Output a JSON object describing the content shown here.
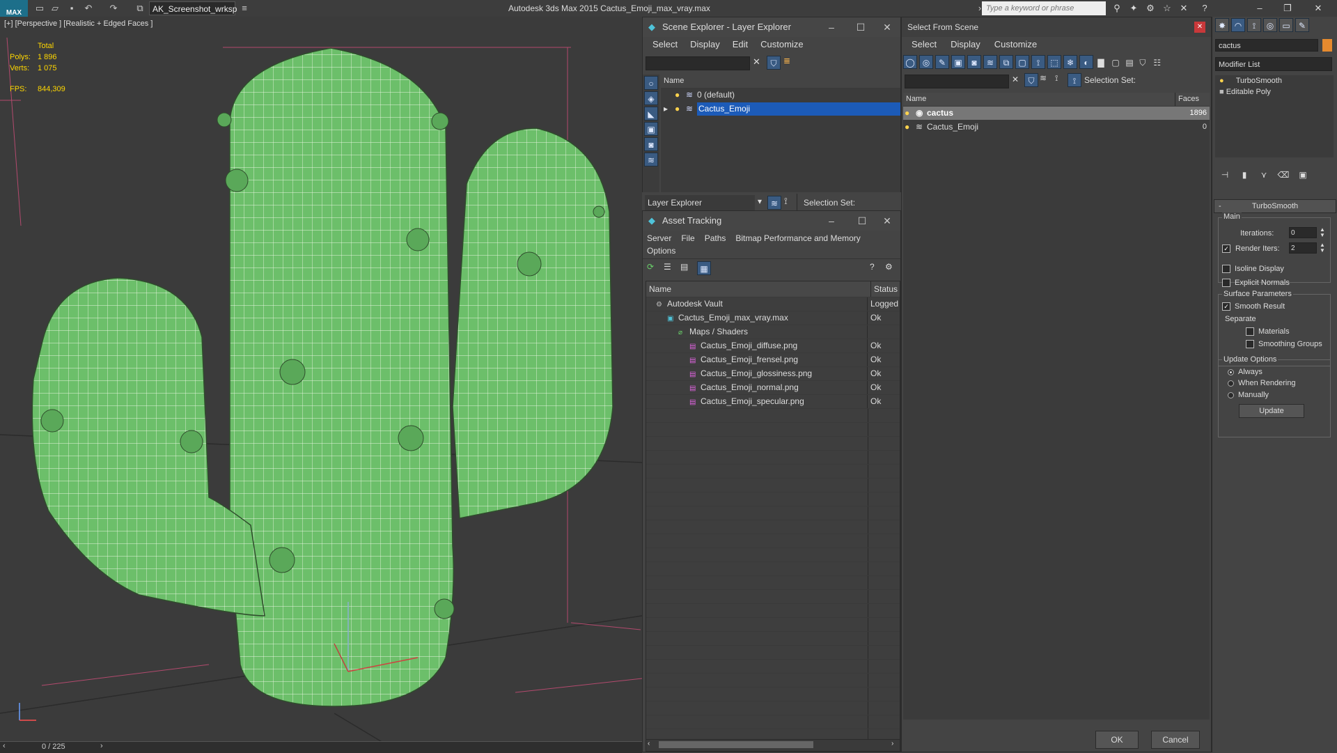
{
  "app": {
    "logo": "MAX",
    "workspace": "AK_Screenshot_wrksp",
    "title": "Autodesk 3ds Max  2015     Cactus_Emoji_max_vray.max",
    "search_placeholder": "Type a keyword or phrase"
  },
  "viewport": {
    "label": "[+] [Perspective ] [Realistic + Edged Faces ]",
    "stats": {
      "total_label": "Total",
      "polys_label": "Polys:",
      "polys": "1 896",
      "verts_label": "Verts:",
      "verts": "1 075",
      "fps_label": "FPS:",
      "fps": "844,309"
    },
    "time_slider": "0 / 225"
  },
  "scene_explorer": {
    "title": "Scene Explorer - Layer Explorer",
    "menu": [
      "Select",
      "Display",
      "Edit",
      "Customize"
    ],
    "column_name": "Name",
    "layers": [
      {
        "name": "0 (default)",
        "selected": false
      },
      {
        "name": "Cactus_Emoji",
        "selected": true
      }
    ],
    "footer_dropdown": "Layer Explorer",
    "selection_set_label": "Selection Set:"
  },
  "asset_tracking": {
    "title": "Asset Tracking",
    "menu": [
      "Server",
      "File",
      "Paths",
      "Bitmap Performance and Memory"
    ],
    "menu2": "Options",
    "col_name": "Name",
    "col_status": "Status",
    "rows": [
      {
        "name": "Autodesk Vault",
        "status": "Logged",
        "indent": 0
      },
      {
        "name": "Cactus_Emoji_max_vray.max",
        "status": "Ok",
        "indent": 1
      },
      {
        "name": "Maps / Shaders",
        "status": "",
        "indent": 2
      },
      {
        "name": "Cactus_Emoji_diffuse.png",
        "status": "Ok",
        "indent": 3
      },
      {
        "name": "Cactus_Emoji_frensel.png",
        "status": "Ok",
        "indent": 3
      },
      {
        "name": "Cactus_Emoji_glossiness.png",
        "status": "Ok",
        "indent": 3
      },
      {
        "name": "Cactus_Emoji_normal.png",
        "status": "Ok",
        "indent": 3
      },
      {
        "name": "Cactus_Emoji_specular.png",
        "status": "Ok",
        "indent": 3
      }
    ]
  },
  "select_from_scene": {
    "title": "Select From Scene",
    "menu": [
      "Select",
      "Display",
      "Customize"
    ],
    "selection_set_label": "Selection Set:",
    "col_name": "Name",
    "col_faces": "Faces",
    "rows": [
      {
        "name": "cactus",
        "faces": "1896",
        "selected": true
      },
      {
        "name": "Cactus_Emoji",
        "faces": "0",
        "selected": false
      }
    ],
    "ok_label": "OK",
    "cancel_label": "Cancel"
  },
  "command_panel": {
    "object_name": "cactus",
    "modifier_list": "Modifier List",
    "stack": [
      "TurboSmooth",
      "Editable Poly"
    ],
    "rollout_title": "TurboSmooth",
    "main_label": "Main",
    "iterations_label": "Iterations:",
    "iterations": "0",
    "render_iters_label": "Render Iters:",
    "render_iters": "2",
    "isoline_label": "Isoline Display",
    "explicit_normals_label": "Explicit Normals",
    "surface_params_label": "Surface Parameters",
    "smooth_result_label": "Smooth Result",
    "separate_label": "Separate",
    "materials_label": "Materials",
    "smoothing_groups_label": "Smoothing Groups",
    "update_options_label": "Update Options",
    "always_label": "Always",
    "when_rendering_label": "When Rendering",
    "manually_label": "Manually",
    "update_button": "Update"
  },
  "colors": {
    "accent": "#1c5bb8",
    "cactus": "#6cbf6a",
    "stats": "#ffd700"
  }
}
